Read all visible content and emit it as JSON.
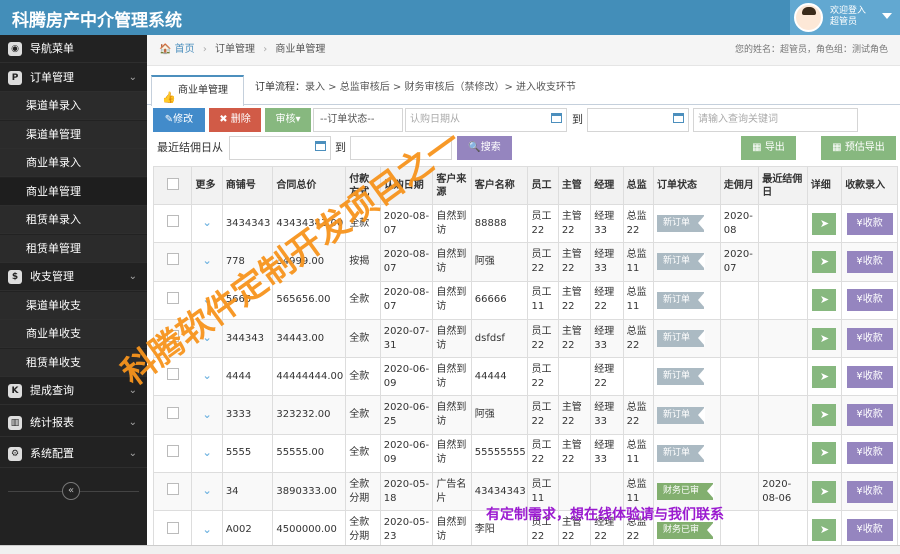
{
  "header": {
    "brand": "科腾房产中介管理系统",
    "welcome_line1": "欢迎登入",
    "welcome_line2": "超管员"
  },
  "sidebar": {
    "nav_menu": "导航菜单",
    "groups": [
      {
        "label": "订单管理",
        "icon": "P",
        "items": [
          "渠道单录入",
          "渠道单管理",
          "商业单录入",
          "商业单管理",
          "租赁单录入",
          "租赁单管理"
        ]
      },
      {
        "label": "收支管理",
        "icon": "$",
        "items": [
          "渠道单收支",
          "商业单收支",
          "租赁单收支"
        ]
      }
    ],
    "bottom_items": [
      "提成查询",
      "统计报表",
      "系统配置"
    ],
    "collapse_label": "«"
  },
  "breadcrumb": {
    "home": "首页",
    "level1": "订单管理",
    "level2": "商业单管理"
  },
  "user_info": "您的姓名：超管员，角色组：测试角色",
  "tab": {
    "label": "商业单管理"
  },
  "flow": {
    "prefix": "订单流程：",
    "steps": "录入 > 总监审核后 > 财务审核后（禁修改）> 进入收支环节"
  },
  "toolbar": {
    "edit": "✎修改",
    "delete": "✖ 删除",
    "audit": "审核▾",
    "status_select": "--订单状态--",
    "purchase_date_placeholder": "认购日期从",
    "to1": "到",
    "search_placeholder": "请输入查询关键词",
    "commission_date_label": "最近结佣日从",
    "to2": "到",
    "search_button": "🔍搜索",
    "export": "导出",
    "export_estimate": "预估导出"
  },
  "table": {
    "headers": [
      "",
      "更多",
      "商铺号",
      "合同总价",
      "付款方式",
      "认购日期",
      "客户来源",
      "客户名称",
      "员工",
      "主管",
      "经理",
      "总监",
      "订单状态",
      "走佣月",
      "最近结佣日",
      "详细",
      "收款录入"
    ],
    "rows": [
      [
        "3434343",
        "43434343.00",
        "全款",
        "2020-08-07",
        "自然到访",
        "88888",
        "员工22",
        "主管22",
        "经理33",
        "总监22",
        "新订单",
        "2020-08",
        ""
      ],
      [
        "778",
        "34999.00",
        "按揭",
        "2020-08-07",
        "自然到访",
        "阿强",
        "员工22",
        "主管22",
        "经理33",
        "总监11",
        "新订单",
        "2020-07",
        ""
      ],
      [
        "5665",
        "565656.00",
        "全款",
        "2020-08-07",
        "自然到访",
        "66666",
        "员工11",
        "主管22",
        "经理22",
        "总监11",
        "新订单",
        "",
        ""
      ],
      [
        "344343",
        "34443.00",
        "全款",
        "2020-07-31",
        "自然到访",
        "dsfdsf",
        "员工22",
        "主管22",
        "经理33",
        "总监22",
        "新订单",
        "",
        ""
      ],
      [
        "4444",
        "44444444.00",
        "全款",
        "2020-06-09",
        "自然到访",
        "44444",
        "员工22",
        "",
        "经理22",
        "",
        "新订单",
        "",
        ""
      ],
      [
        "3333",
        "323232.00",
        "全款",
        "2020-06-25",
        "自然到访",
        "阿强",
        "员工22",
        "主管22",
        "经理33",
        "总监22",
        "新订单",
        "",
        ""
      ],
      [
        "5555",
        "55555.00",
        "全款",
        "2020-06-09",
        "自然到访",
        "55555555",
        "员工22",
        "主管22",
        "经理33",
        "总监11",
        "新订单",
        "",
        ""
      ],
      [
        "34",
        "3890333.00",
        "全款分期",
        "2020-05-18",
        "广告名片",
        "43434343",
        "员工11",
        "",
        "",
        "总监11",
        "财务已审",
        "",
        "2020-08-06"
      ],
      [
        "A002",
        "4500000.00",
        "全款分期",
        "2020-05-23",
        "自然到访",
        "李阳",
        "员工22",
        "主管22",
        "经理22",
        "总监22",
        "财务已审",
        "",
        ""
      ]
    ],
    "pay_label": "¥收款"
  },
  "watermark": "科腾软件定制开发项目之一",
  "promo": "有定制需求，想在线体验请与我们联系"
}
